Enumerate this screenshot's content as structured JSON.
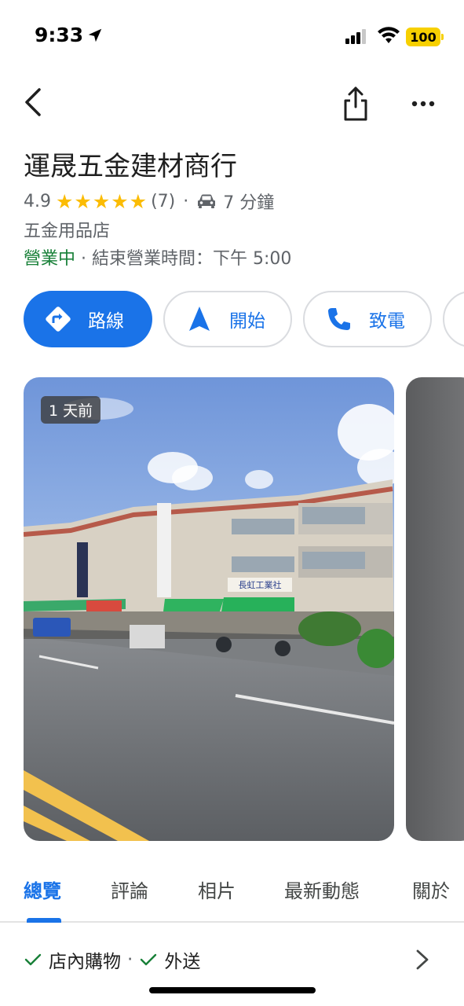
{
  "status_bar": {
    "time": "9:33",
    "battery": "100"
  },
  "place": {
    "title": "運晟五金建材商行",
    "rating": "4.9",
    "stars": "★★★★★",
    "review_count": "(7)",
    "drive_time": "7 分鐘",
    "category": "五金用品店",
    "open_status": "營業中",
    "hours_text": "結束營業時間：下午 5:00"
  },
  "actions": {
    "directions": "路線",
    "start": "開始",
    "call": "致電"
  },
  "photo": {
    "badge": "1 天前",
    "sign_text": "長虹工業社"
  },
  "tabs": [
    {
      "label": "總覽",
      "active": true
    },
    {
      "label": "評論",
      "active": false
    },
    {
      "label": "相片",
      "active": false
    },
    {
      "label": "最新動態",
      "active": false
    },
    {
      "label": "關於",
      "active": false
    }
  ],
  "features": {
    "item1": "店內購物",
    "item2": "外送"
  },
  "colors": {
    "accent": "#1a73e8",
    "open_green": "#188038",
    "star": "#fbbc04",
    "battery": "#f7d000"
  },
  "icons": [
    "location-arrow-icon",
    "signal-icon",
    "wifi-icon",
    "back-icon",
    "share-icon",
    "more-icon",
    "car-icon",
    "directions-icon",
    "navigation-icon",
    "phone-icon",
    "check-icon",
    "chevron-right-icon"
  ]
}
